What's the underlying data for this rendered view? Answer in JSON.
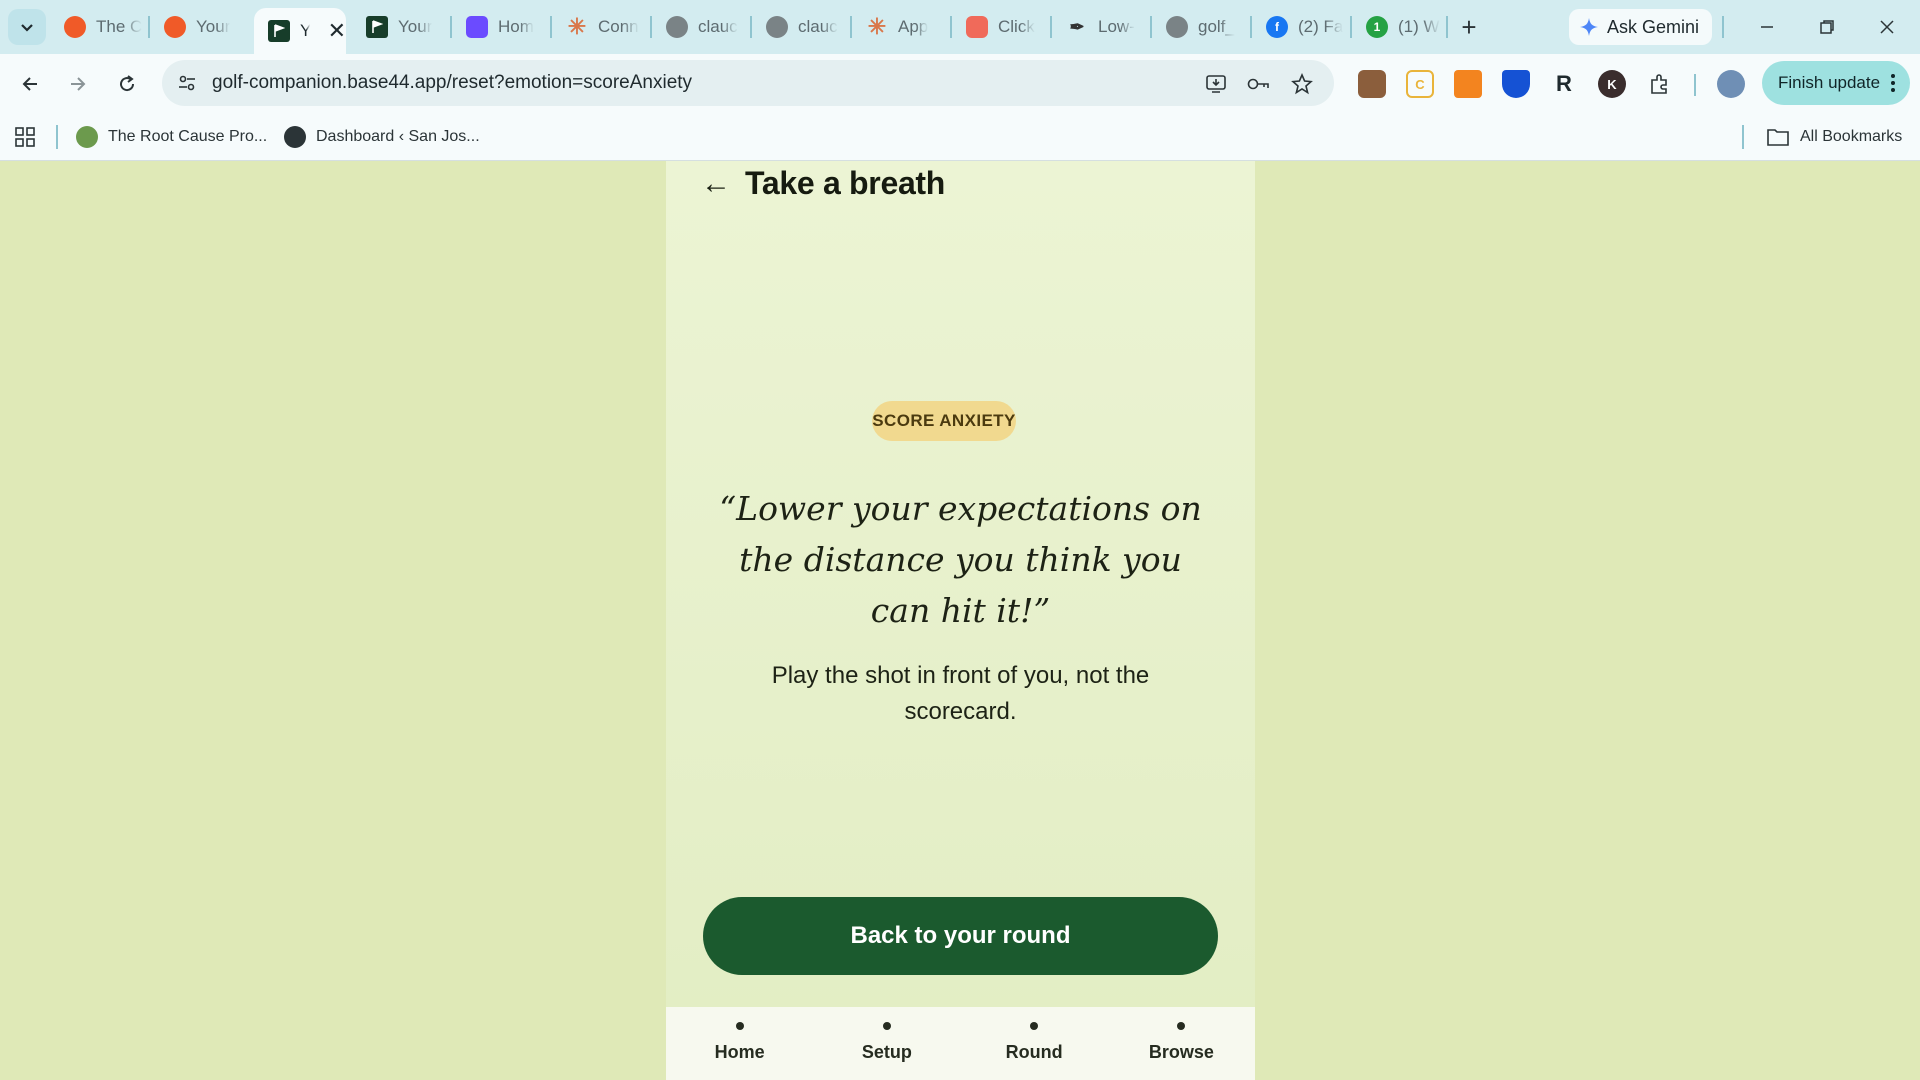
{
  "browser": {
    "tabs": [
      {
        "label": "The C",
        "icon": "orange-circle-icon",
        "color": "#f05a28"
      },
      {
        "label": "Your",
        "icon": "orange-circle-icon",
        "color": "#f05a28"
      },
      {
        "label": "Y",
        "icon": "golf-flag-icon",
        "color": "#173d2a",
        "active": true
      },
      {
        "label": "Your",
        "icon": "golf-flag-icon",
        "color": "#173d2a"
      },
      {
        "label": "Hom",
        "icon": "purple-square-icon",
        "color": "#6b4bff"
      },
      {
        "label": "Conn",
        "icon": "claude-asterisk-icon",
        "color": "#d9774a"
      },
      {
        "label": "clauc",
        "icon": "globe-icon",
        "color": "#7a8386"
      },
      {
        "label": "clauc",
        "icon": "globe-icon",
        "color": "#7a8386"
      },
      {
        "label": "App",
        "icon": "claude-asterisk-icon",
        "color": "#d9774a"
      },
      {
        "label": "Click",
        "icon": "clickup-icon",
        "color": "#f06a5a"
      },
      {
        "label": "Low-",
        "icon": "feather-icon",
        "color": "#333333"
      },
      {
        "label": "golf_",
        "icon": "globe-icon",
        "color": "#7a8386"
      },
      {
        "label": "(2) Fa",
        "icon": "facebook-icon",
        "color": "#1877f2"
      },
      {
        "label": "(1) W",
        "icon": "whatsapp-icon",
        "color": "#25a244"
      }
    ],
    "tab_close": "✕",
    "new_tab": "+",
    "gemini_label": "Ask Gemini",
    "url": "golf-companion.base44.app/reset?emotion=scoreAnxiety",
    "finish_update": "Finish update",
    "bookmarks": [
      {
        "label": "The Root Cause Pro...",
        "icon": "tree-icon"
      },
      {
        "label": "Dashboard ‹ San Jos...",
        "icon": "wordpress-icon"
      }
    ],
    "all_bookmarks": "All Bookmarks"
  },
  "page": {
    "title": "Take a breath",
    "back_arrow": "←",
    "badge": "SCORE ANXIETY",
    "quote": "“Lower your expectations on the distance you think you can hit it!”",
    "subtext": "Play the shot in front of you, not the scorecard.",
    "cta": "Back to your round",
    "nav": [
      "Home",
      "Setup",
      "Round",
      "Browse"
    ]
  },
  "colors": {
    "page_bg": "#dfe9b7",
    "badge_bg": "#f1d98f",
    "cta_bg": "#1b5a2e"
  }
}
